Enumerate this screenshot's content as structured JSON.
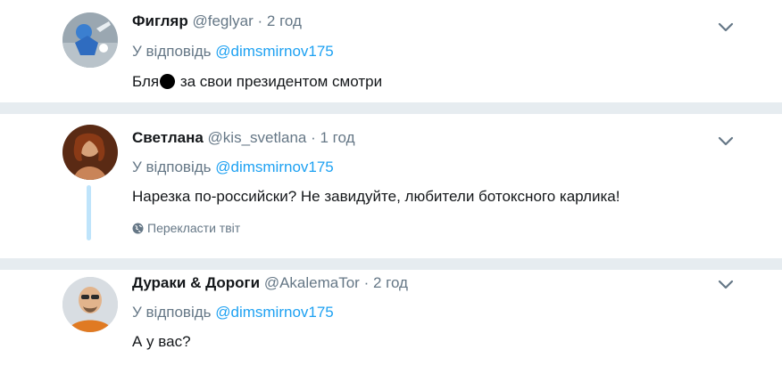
{
  "colors": {
    "link": "#1da1f2",
    "secondary_text": "#657786",
    "separator": "#e6ecf0",
    "thread_line": "#bfe4fb"
  },
  "tweets": [
    {
      "author_name": "Фигляр",
      "handle": "@feglyar",
      "dot": "·",
      "time": "2 год",
      "reply_prefix": "У відповідь",
      "reply_to": "@dimsmirnov175",
      "text_before": "Бля",
      "text_after": " за свои президентом смотри",
      "icon": "chevron-down-icon"
    },
    {
      "author_name": "Светлана",
      "handle": "@kis_svetlana",
      "dot": "·",
      "time": "1 год",
      "reply_prefix": "У відповідь",
      "reply_to": "@dimsmirnov175",
      "text": "Нарезка по-российски? Не завидуйте, любители ботоксного карлика!",
      "translate_label": "Перекласти твіт",
      "icon": "chevron-down-icon"
    },
    {
      "author_name": "Дураки & Дороги",
      "handle": "@AkalemaTor",
      "dot": "·",
      "time": "2 год",
      "reply_prefix": "У відповідь",
      "reply_to": "@dimsmirnov175",
      "text": "А у вас?",
      "icon": "chevron-down-icon"
    }
  ]
}
